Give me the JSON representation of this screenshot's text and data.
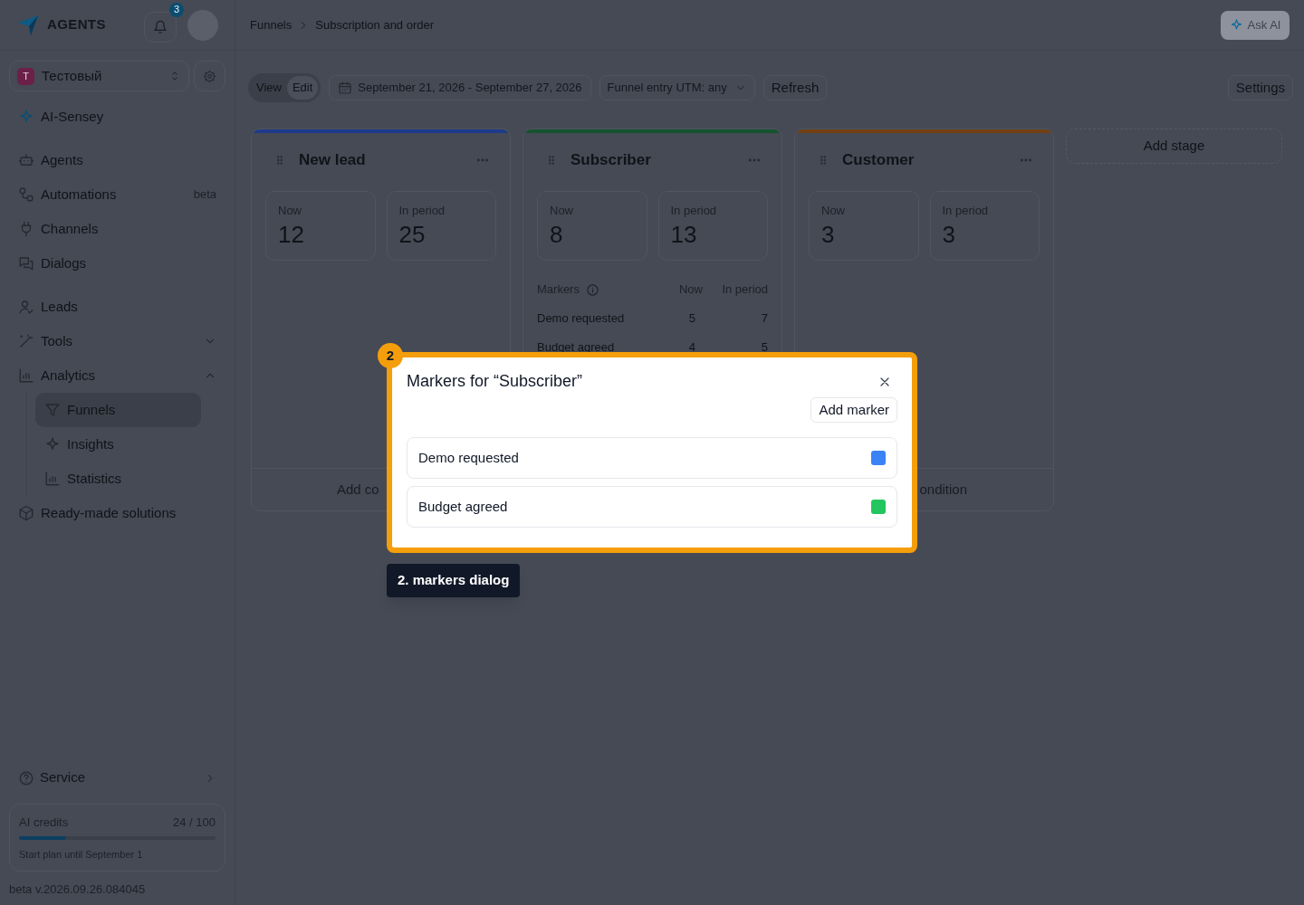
{
  "brand": {
    "name": "AGENTS"
  },
  "notifications": {
    "count": "3"
  },
  "workspace": {
    "initial": "T",
    "name": "Тестовый"
  },
  "sidebar": {
    "sections": [
      [
        {
          "label": "AI-Sensey",
          "selected": false
        }
      ],
      [
        {
          "label": "Agents",
          "selected": false
        },
        {
          "label": "Automations",
          "badge": "beta",
          "selected": false
        },
        {
          "label": "Channels",
          "selected": false
        },
        {
          "label": "Dialogs",
          "selected": false
        }
      ],
      [
        {
          "label": "Leads",
          "selected": false
        },
        {
          "label": "Tools",
          "selected": false,
          "expanded": false
        },
        {
          "label": "Analytics",
          "selected": false,
          "expanded": true,
          "children": [
            {
              "label": "Funnels",
              "selected": true
            },
            {
              "label": "Insights",
              "selected": false
            },
            {
              "label": "Statistics",
              "selected": false
            }
          ]
        },
        {
          "label": "Ready-made solutions",
          "selected": false
        }
      ]
    ]
  },
  "service": {
    "label": "Service"
  },
  "credits": {
    "label": "AI credits",
    "value": "24 / 100",
    "level": 0.24,
    "note": "Start plan until September 1"
  },
  "version": "beta v.2026.09.26.084045",
  "breadcrumbs": [
    "Funnels",
    "Subscription and order"
  ],
  "ask_ai": {
    "label": "Ask AI"
  },
  "toolbar": {
    "modes": [
      {
        "label": "View",
        "selected": false
      },
      {
        "label": "Edit",
        "selected": true
      }
    ],
    "date_range": "September 21, 2026 - September 27, 2026",
    "filter": "Funnel entry UTM: any",
    "refresh": "Refresh",
    "settings": "Settings"
  },
  "stages": [
    {
      "title": "New lead",
      "color": "#1e3a8a",
      "now_label": "Now",
      "now": "12",
      "period_label": "In period",
      "period": "25",
      "footer": {
        "text": "Add co",
        "right_aligned": false
      }
    },
    {
      "title": "Subscriber",
      "color": "#14532d",
      "now_label": "Now",
      "now": "8",
      "period_label": "In period",
      "period": "13",
      "markers": {
        "label": "Markers",
        "now_label": "Now",
        "period_label": "In period",
        "rows": [
          {
            "name": "Demo requested",
            "now": "5",
            "period": "7"
          },
          {
            "name": "Budget agreed",
            "now": "4",
            "period": "5"
          }
        ]
      }
    },
    {
      "title": "Customer",
      "color": "#713f12",
      "now_label": "Now",
      "now": "3",
      "period_label": "In period",
      "period": "3",
      "footer": {
        "text": "ondition",
        "right_aligned": true
      }
    }
  ],
  "add_stage": "Add stage",
  "dialog": {
    "title": "Markers for “Subscriber”",
    "add_button": "Add marker",
    "markers": [
      {
        "name": "Demo requested",
        "color": "#3b82f6"
      },
      {
        "name": "Budget agreed",
        "color": "#22c55e"
      }
    ]
  },
  "annotation": {
    "number": "2",
    "label": "2. markers dialog"
  }
}
